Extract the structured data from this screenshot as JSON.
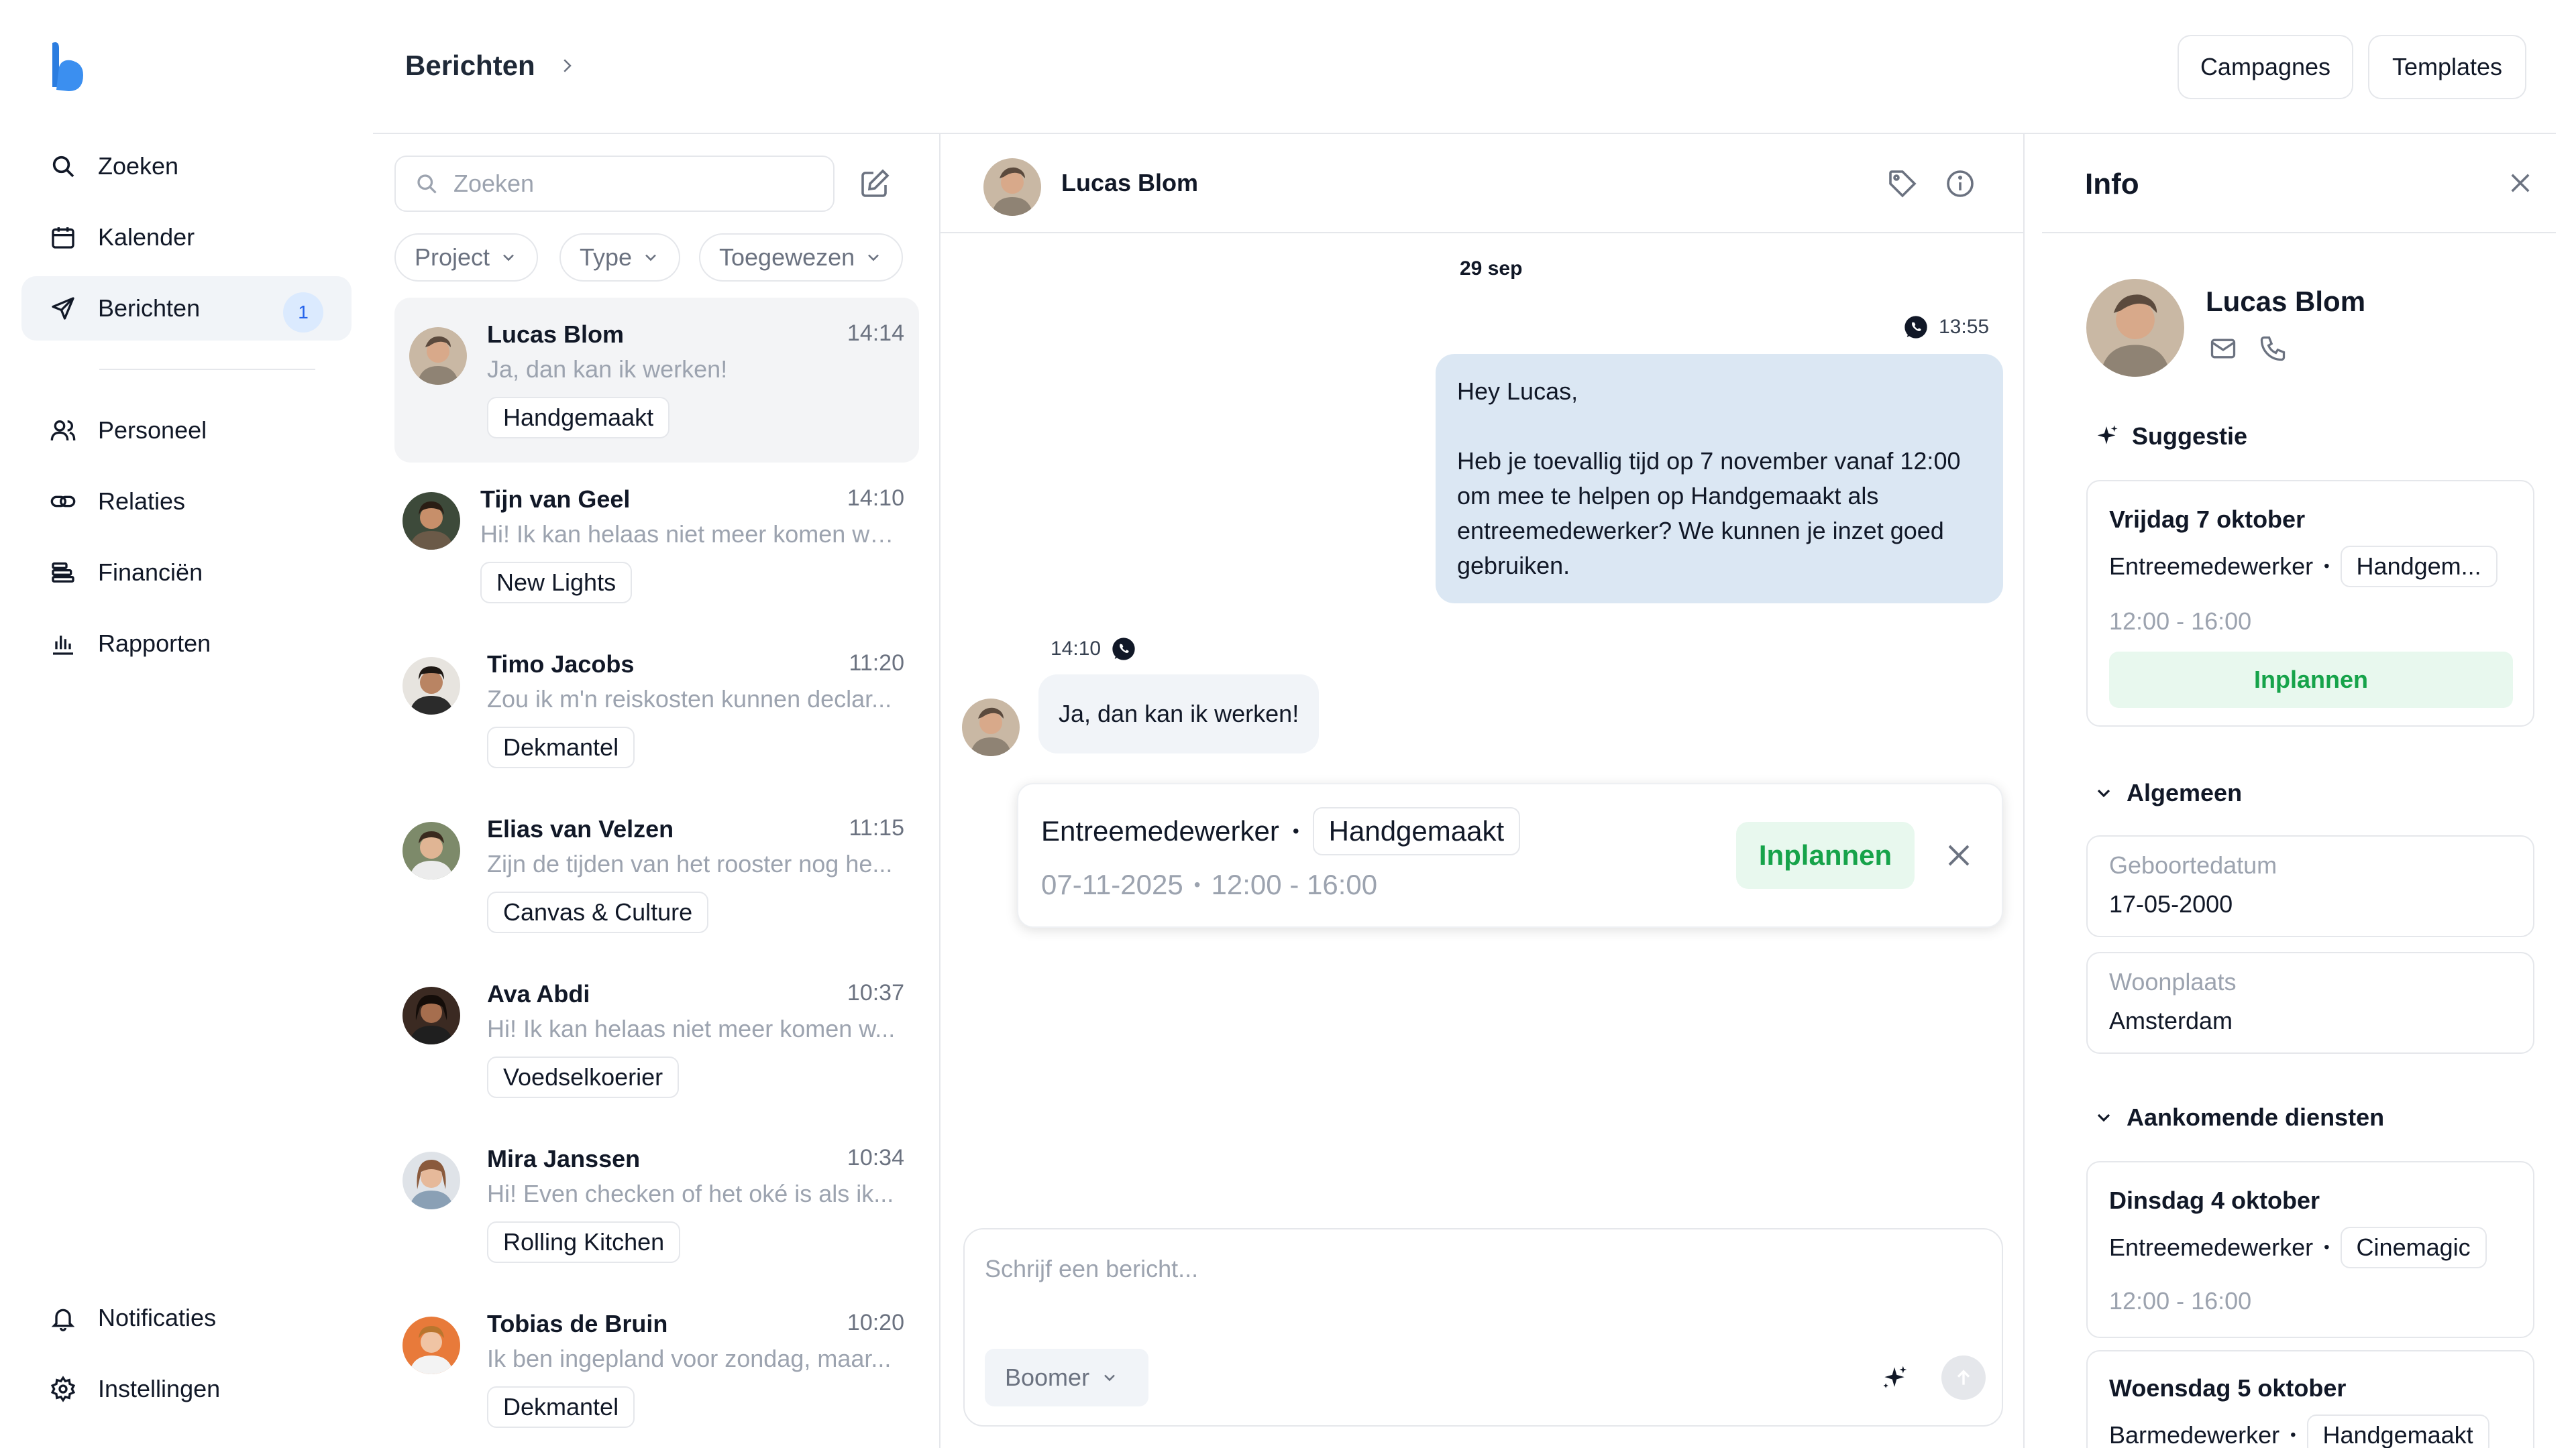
{
  "nav": {
    "items": [
      {
        "label": "Zoeken",
        "icon": "search-icon"
      },
      {
        "label": "Kalender",
        "icon": "calendar-icon"
      },
      {
        "label": "Berichten",
        "icon": "send-icon",
        "badge": "1",
        "active": true
      },
      {
        "label": "Personeel",
        "icon": "users-icon"
      },
      {
        "label": "Relaties",
        "icon": "link-icon"
      },
      {
        "label": "Financiën",
        "icon": "coins-icon"
      },
      {
        "label": "Rapporten",
        "icon": "bar-chart-icon"
      }
    ],
    "bottom": [
      {
        "label": "Notificaties",
        "icon": "bell-icon"
      },
      {
        "label": "Instellingen",
        "icon": "gear-icon"
      }
    ]
  },
  "header": {
    "breadcrumb": "Berichten",
    "buttons": {
      "campaigns": "Campagnes",
      "templates": "Templates"
    }
  },
  "list": {
    "search_placeholder": "Zoeken",
    "filters": [
      "Project",
      "Type",
      "Toegewezen"
    ],
    "conversations": [
      {
        "name": "Lucas Blom",
        "time": "14:14",
        "preview": "Ja, dan kan ik werken!",
        "tag": "Handgemaakt",
        "selected": true
      },
      {
        "name": "Tijn van Geel",
        "time": "14:10",
        "preview": "Hi! Ik kan helaas niet meer komen we...",
        "tag": "New Lights"
      },
      {
        "name": "Timo Jacobs",
        "time": "11:20",
        "preview": "Zou ik m'n reiskosten kunnen declar...",
        "tag": "Dekmantel"
      },
      {
        "name": "Elias van Velzen",
        "time": "11:15",
        "preview": "Zijn de tijden van het rooster nog he...",
        "tag": "Canvas & Culture"
      },
      {
        "name": "Ava Abdi",
        "time": "10:37",
        "preview": "Hi! Ik kan helaas niet meer komen w...",
        "tag": "Voedselkoerier"
      },
      {
        "name": "Mira Janssen",
        "time": "10:34",
        "preview": "Hi! Even checken of het oké is als ik...",
        "tag": "Rolling Kitchen"
      },
      {
        "name": "Tobias de Bruin",
        "time": "10:20",
        "preview": "Ik ben ingepland voor zondag, maar...",
        "tag": "Dekmantel"
      }
    ]
  },
  "chat": {
    "contact": "Lucas Blom",
    "date": "29 sep",
    "out_time": "13:55",
    "out_lines": [
      "Hey Lucas,",
      "",
      "Heb je toevallig tijd op 7 november vanaf 12:00",
      "om mee te helpen op Handgemaakt als",
      "entreemedewerker? We kunnen je inzet goed",
      "gebruiken."
    ],
    "in_time": "14:10",
    "in_text": "Ja, dan kan ik werken!",
    "card": {
      "role": "Entreemedewerker",
      "project": "Handgemaakt",
      "date": "07-11-2025",
      "time": "12:00 - 16:00",
      "action": "Inplannen"
    },
    "composer": {
      "placeholder": "Schrijf een bericht...",
      "sender": "Boomer"
    }
  },
  "info": {
    "title": "Info",
    "name": "Lucas Blom",
    "suggestion": {
      "heading": "Suggestie",
      "day": "Vrijdag 7 oktober",
      "role": "Entreemedewerker",
      "project": "Handgem...",
      "time": "12:00 - 16:00",
      "action": "Inplannen"
    },
    "general": {
      "heading": "Algemeen",
      "birth_label": "Geboortedatum",
      "birth_value": "17-05-2000",
      "city_label": "Woonplaats",
      "city_value": "Amsterdam"
    },
    "upcoming": {
      "heading": "Aankomende diensten",
      "shifts": [
        {
          "day": "Dinsdag 4 oktober",
          "role": "Entreemedewerker",
          "project": "Cinemagic",
          "time": "12:00 - 16:00"
        },
        {
          "day": "Woensdag 5 oktober",
          "role": "Barmedewerker",
          "project": "Handgemaakt"
        }
      ]
    }
  },
  "colors": {
    "brand": "#2b7de0",
    "accent_green": "#16a34a",
    "bubble_out": "#dbe7f3"
  }
}
